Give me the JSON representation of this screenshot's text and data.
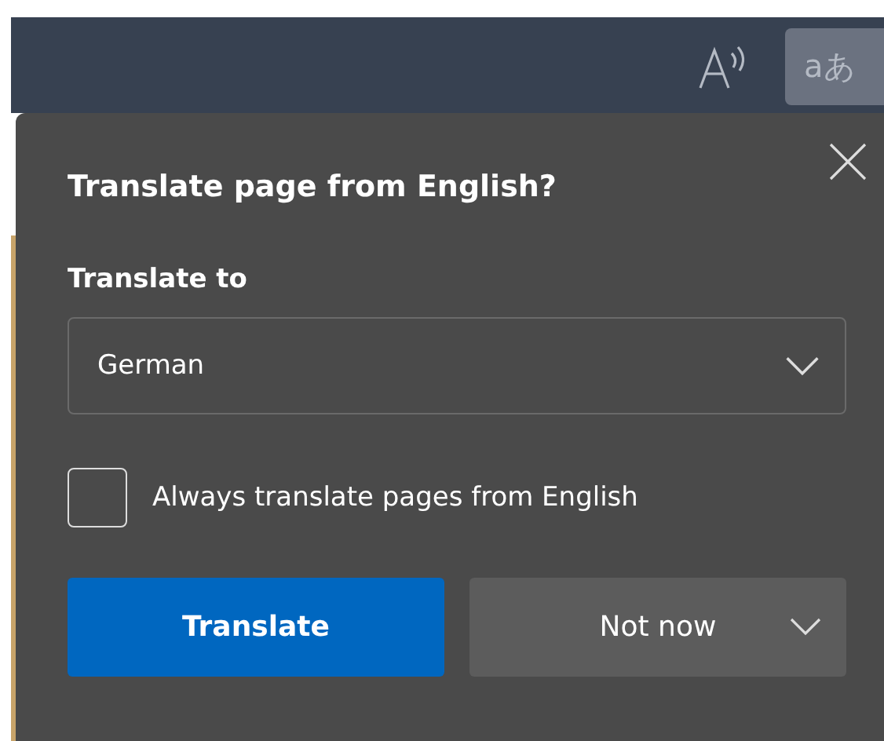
{
  "toolbar": {
    "translate_button": {
      "label": "aあ",
      "selected": true
    }
  },
  "dialog": {
    "title": "Translate page from English?",
    "target_label": "Translate to",
    "language_select": {
      "value": "German"
    },
    "always_checkbox": {
      "label": "Always translate pages from English",
      "checked": false
    },
    "buttons": [
      {
        "kind": "primary",
        "label": "Translate"
      },
      {
        "kind": "split",
        "label": "Not now"
      }
    ]
  }
}
